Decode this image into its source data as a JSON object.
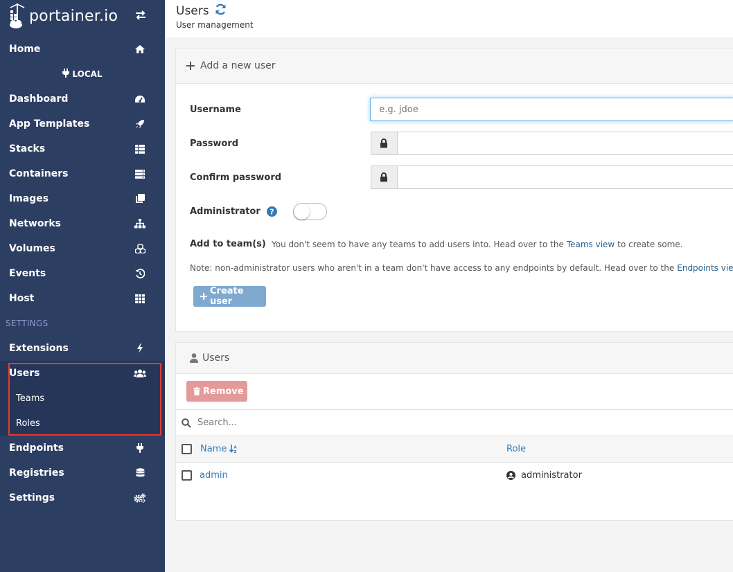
{
  "brand": {
    "name": "portainer.io"
  },
  "sidebar": {
    "home": "Home",
    "endpoint": "LOCAL",
    "items": [
      {
        "label": "Dashboard",
        "icon": "tachometer-icon"
      },
      {
        "label": "App Templates",
        "icon": "rocket-icon"
      },
      {
        "label": "Stacks",
        "icon": "th-list-icon"
      },
      {
        "label": "Containers",
        "icon": "server-icon"
      },
      {
        "label": "Images",
        "icon": "clone-icon"
      },
      {
        "label": "Networks",
        "icon": "sitemap-icon"
      },
      {
        "label": "Volumes",
        "icon": "cubes-icon"
      },
      {
        "label": "Events",
        "icon": "history-icon"
      },
      {
        "label": "Host",
        "icon": "th-icon"
      }
    ],
    "settings_title": "SETTINGS",
    "settings_items": {
      "extensions": "Extensions",
      "users": "Users",
      "teams": "Teams",
      "roles": "Roles",
      "endpoints": "Endpoints",
      "registries": "Registries",
      "settings": "Settings"
    },
    "accent_color": "#2d3e63"
  },
  "header": {
    "title": "Users",
    "subtitle": "User management"
  },
  "add_user": {
    "title": "Add a new user",
    "username_label": "Username",
    "username_placeholder": "e.g. jdoe",
    "password_label": "Password",
    "confirm_label": "Confirm password",
    "admin_label": "Administrator",
    "teams_label": "Add to team(s)",
    "teams_text_1": "You don't seem to have any teams to add users into. Head over to the",
    "teams_link": "Teams view",
    "teams_text_2": "to create some.",
    "note_text": "Note: non-administrator users who aren't in a team don't have access to any endpoints by default. Head over to the",
    "note_link": "Endpoints view",
    "create_button": "Create user"
  },
  "users_panel": {
    "title": "Users",
    "remove_button": "Remove",
    "search_placeholder": "Search...",
    "columns": {
      "name": "Name",
      "role": "Role"
    },
    "rows": [
      {
        "name": "admin",
        "role": "administrator"
      }
    ]
  }
}
